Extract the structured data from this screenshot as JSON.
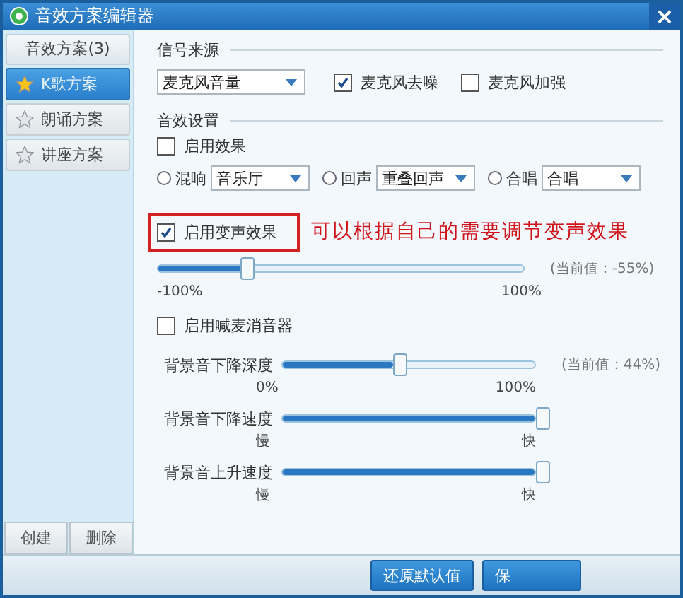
{
  "window": {
    "title": "音效方案编辑器",
    "close": "×"
  },
  "sidebar": {
    "header": "音效方案(3)",
    "items": [
      {
        "label": "K歌方案",
        "selected": true
      },
      {
        "label": "朗诵方案",
        "selected": false
      },
      {
        "label": "讲座方案",
        "selected": false
      }
    ],
    "buttons": [
      "创建",
      "删除"
    ]
  },
  "signal_source": {
    "heading": "信号来源",
    "dropdown": {
      "value": "麦克风音量"
    },
    "checkboxes": [
      {
        "label": "麦克风去噪",
        "checked": true
      },
      {
        "label": "麦克风加强",
        "checked": false
      }
    ]
  },
  "effects": {
    "heading": "音效设置",
    "enable": {
      "label": "启用效果",
      "checked": false
    },
    "radios": [
      {
        "label": "混响",
        "selected": false,
        "dropdown": "音乐厅"
      },
      {
        "label": "回声",
        "selected": false,
        "dropdown": "重叠回声"
      },
      {
        "label": "合唱",
        "selected": false,
        "dropdown": "合唱"
      }
    ],
    "voice_change": {
      "label": "启用变声效果",
      "checked": true,
      "highlighted": true,
      "annotation": "可以根据自己的需要调节变声效果",
      "level": 0.225,
      "reading": "(当前值：-55%)",
      "min": "-100%",
      "max": "100%"
    },
    "mic_silencer": {
      "label": "启用喊麦消音器",
      "checked": false
    },
    "sliders": [
      {
        "label": "背景音下降深度",
        "level": 0.44,
        "reading": "(当前值：44%)",
        "min": "0%",
        "max": "100%"
      },
      {
        "label": "背景音下降速度",
        "level": 1,
        "min": "慢",
        "max": "快"
      },
      {
        "label": "背景音上升速度",
        "level": 1,
        "min": "慢",
        "max": "快"
      }
    ]
  },
  "footer": {
    "buttons": [
      "还原默认值",
      "保"
    ]
  }
}
